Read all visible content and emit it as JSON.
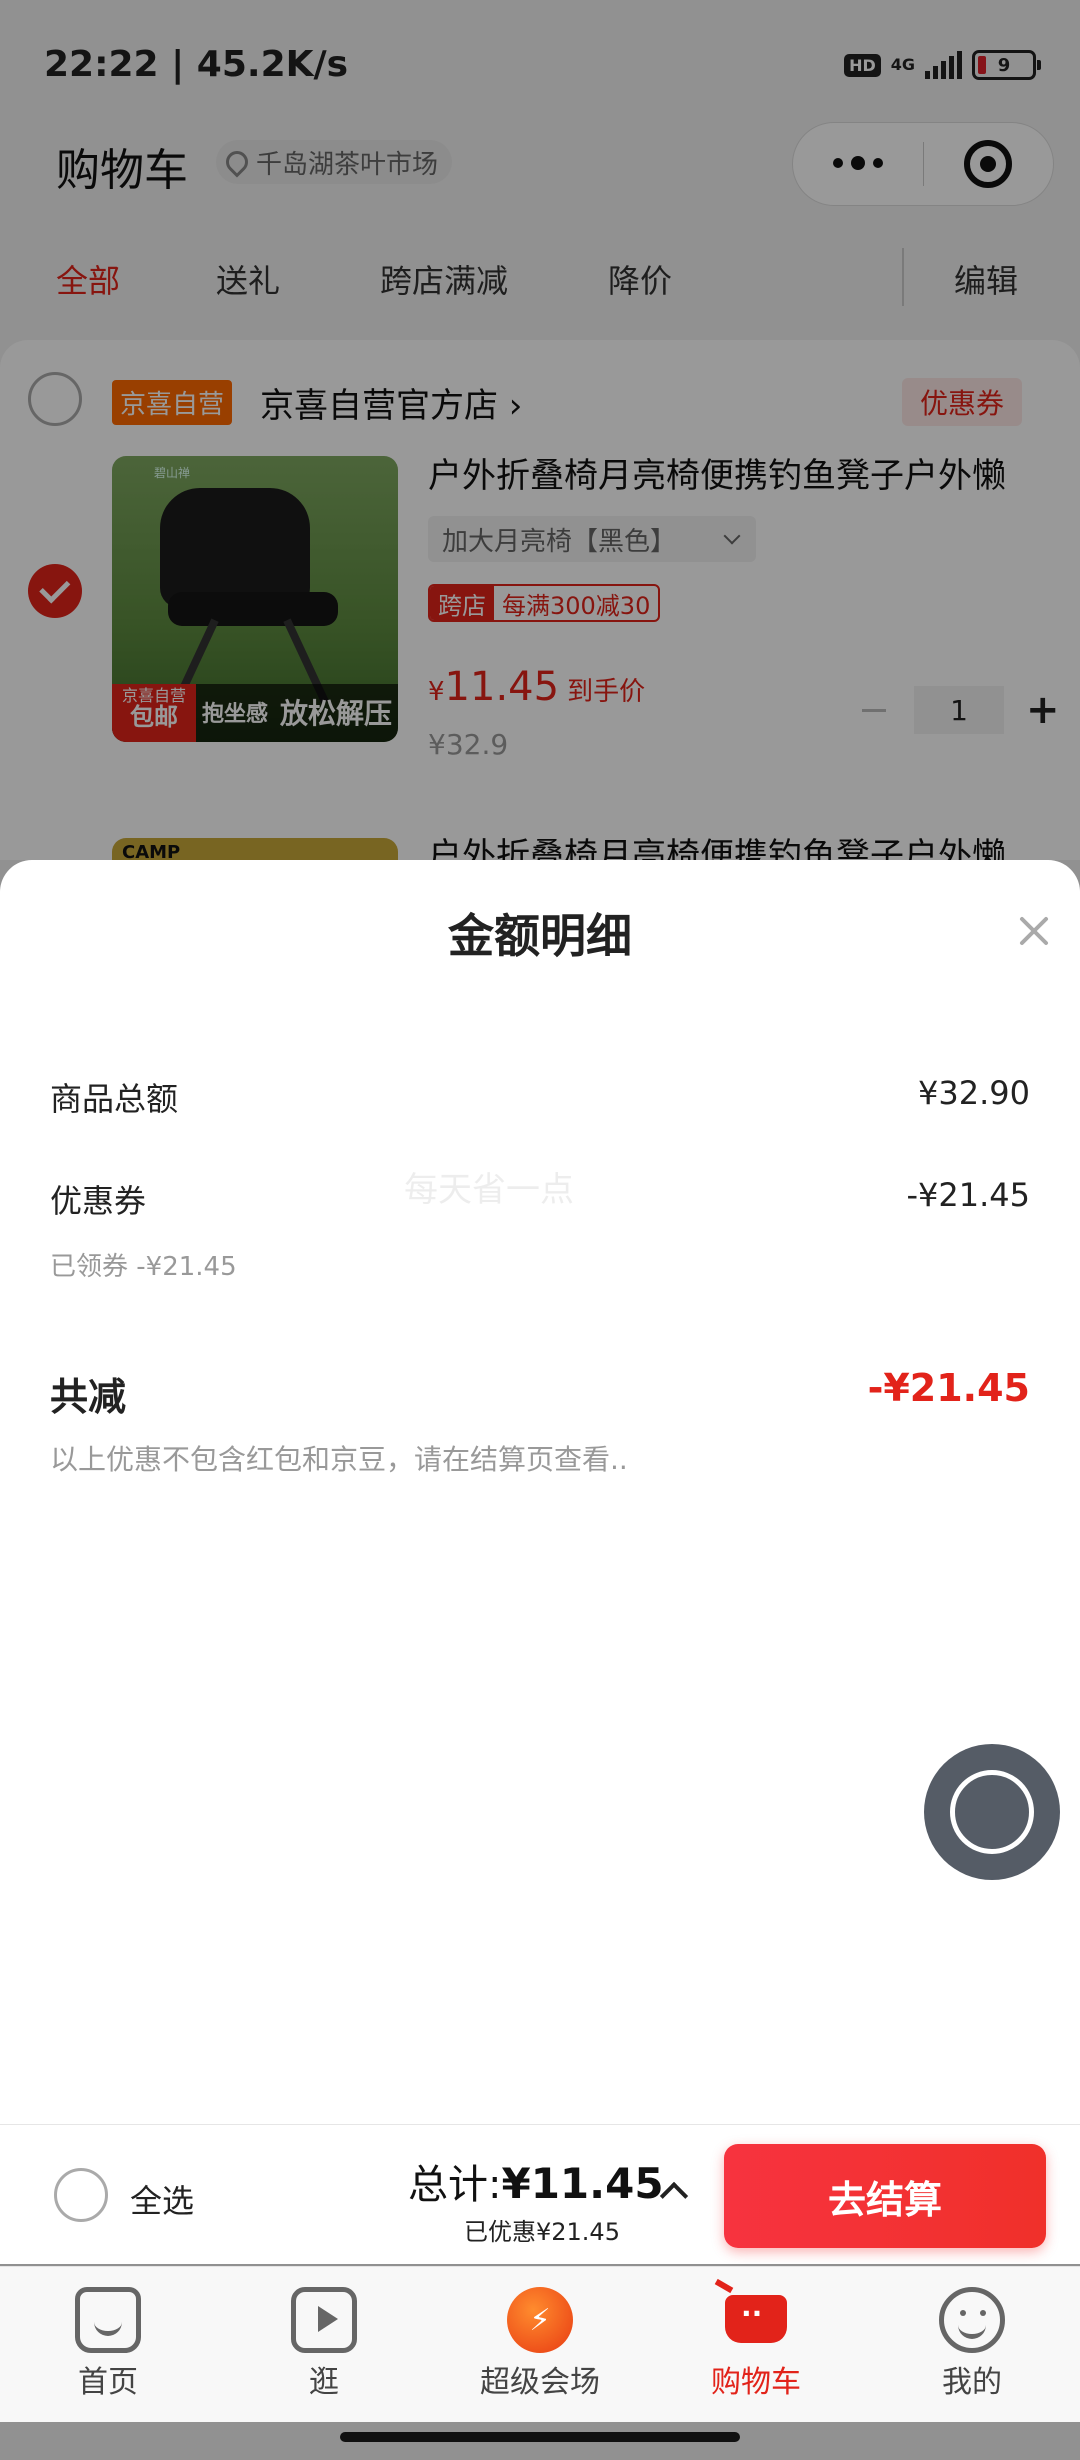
{
  "status_bar": {
    "time_speed": "22:22 | 45.2K/s",
    "hd": "HD",
    "network": "4G",
    "battery": "9"
  },
  "header": {
    "title": "购物车",
    "location": "千岛湖茶叶市场"
  },
  "tabs": [
    {
      "label": "全部",
      "active": true
    },
    {
      "label": "送礼"
    },
    {
      "label": "跨店满减"
    },
    {
      "label": "降价"
    },
    {
      "label": "编辑"
    }
  ],
  "store": {
    "tag": "京喜自营",
    "name": "京喜自营官方店 ›",
    "coupon": "优惠券"
  },
  "product": {
    "title": "户外折叠椅月亮椅便携钓鱼凳子户外懒",
    "sku": "加大月亮椅【黑色】",
    "promo_tag": "跨店",
    "promo_text": "每满300减30",
    "price_symbol": "¥",
    "price_value": "11.45",
    "price_label": "到手价",
    "original_price": "¥32.9",
    "quantity": "1",
    "plus": "+",
    "image_brand": "碧山禅",
    "image_tag_top": "京喜自营",
    "image_tag_bottom": "包邮",
    "image_caption_1": "抱坐感",
    "image_caption_2": "放松解压"
  },
  "product2": {
    "title": "户外折叠椅月亮椅便携钓鱼凳子户外懒",
    "image_label": "CAMP"
  },
  "sheet": {
    "title": "金额明细",
    "goods_total_label": "商品总额",
    "goods_total_value": "¥32.90",
    "coupon_label": "优惠券",
    "coupon_value": "-¥21.45",
    "coupon_sub": "已领券 -¥21.45",
    "total_reduce_label": "共减",
    "total_reduce_value": "-¥21.45",
    "note": "以上优惠不包含红包和京豆，请在结算页查看..",
    "watermark": "每天省一点"
  },
  "checkout": {
    "select_all": "全选",
    "total_prefix": "总计:",
    "total_value": "¥11.45",
    "saved": "已优惠¥21.45",
    "button": "去结算"
  },
  "nav": [
    {
      "label": "首页",
      "icon": "home-icon"
    },
    {
      "label": "逛",
      "icon": "video-icon"
    },
    {
      "label": "超级会场",
      "icon": "super-venue-icon"
    },
    {
      "label": "购物车",
      "icon": "cart-icon",
      "active": true
    },
    {
      "label": "我的",
      "icon": "profile-icon"
    }
  ],
  "colors": {
    "accent": "#e2231a",
    "store_tag": "#ff6a00"
  }
}
